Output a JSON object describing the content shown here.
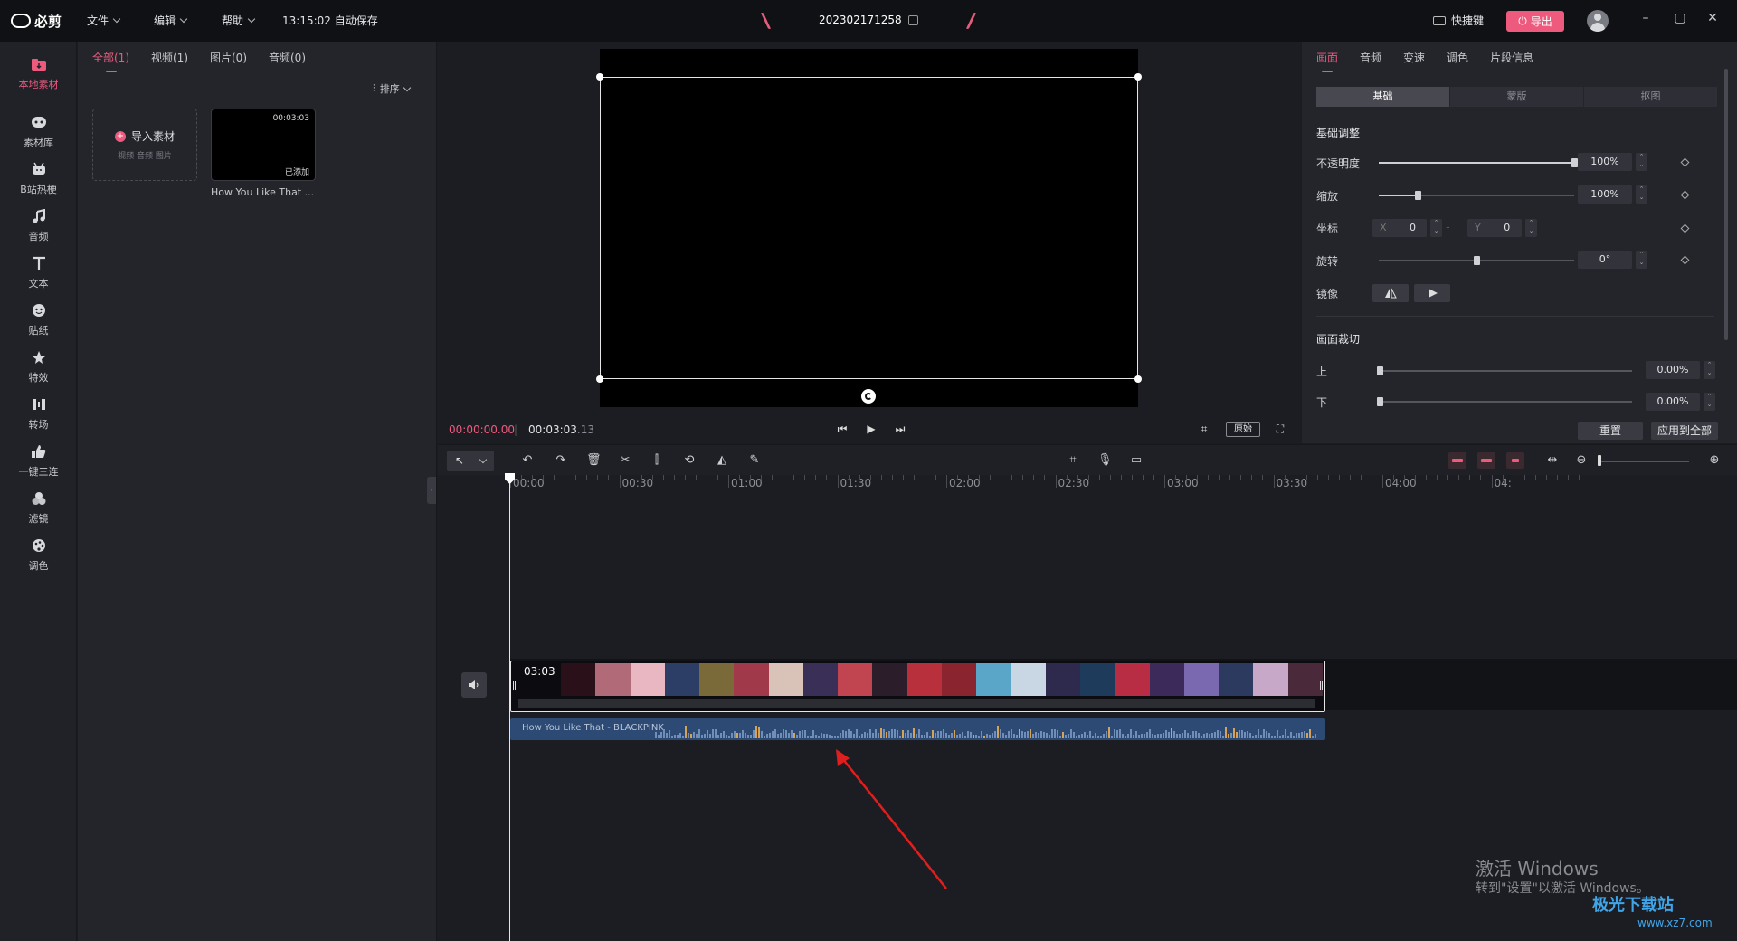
{
  "top": {
    "menus": [
      "文件",
      "编辑",
      "帮助"
    ],
    "autosave": "13:15:02 自动保存",
    "project_title": "202302171258",
    "shortcut": "快捷键",
    "export": "导出"
  },
  "nav": [
    {
      "label": "本地素材",
      "icon": "folder-icon",
      "active": true
    },
    {
      "label": "素材库",
      "icon": "library-icon"
    },
    {
      "label": "B站热梗",
      "icon": "bilibili-icon"
    },
    {
      "label": "音频",
      "icon": "music-icon"
    },
    {
      "label": "文本",
      "icon": "text-icon"
    },
    {
      "label": "贴纸",
      "icon": "sticker-icon"
    },
    {
      "label": "特效",
      "icon": "effect-icon"
    },
    {
      "label": "转场",
      "icon": "transition-icon"
    },
    {
      "label": "一键三连",
      "icon": "thumbs-up-icon"
    },
    {
      "label": "滤镜",
      "icon": "filter-icon"
    },
    {
      "label": "调色",
      "icon": "palette-icon"
    }
  ],
  "media": {
    "tabs": [
      "全部(1)",
      "视频(1)",
      "图片(0)",
      "音频(0)"
    ],
    "sort": "排序",
    "import_title": "导入素材",
    "import_sub": "视频 音频 图片",
    "thumb_duration": "00:03:03",
    "thumb_added": "已添加",
    "thumb_name": "How You Like That ..."
  },
  "preview": {
    "current_time": "00:00:00.00",
    "total_time_main": "00:03:03",
    "total_time_frac": ".13",
    "origin": "原始"
  },
  "props": {
    "tabs": [
      "画面",
      "音频",
      "变速",
      "调色",
      "片段信息"
    ],
    "seg": [
      "基础",
      "蒙版",
      "抠图"
    ],
    "section_basic": "基础调整",
    "opacity_label": "不透明度",
    "opacity_value": "100%",
    "opacity_level": 1.0,
    "scale_label": "缩放",
    "scale_value": "100%",
    "scale_level": 0.2,
    "pos_label": "坐标",
    "pos_x_label": "X",
    "pos_x": "0",
    "pos_y_label": "Y",
    "pos_y": "0",
    "rotate_label": "旋转",
    "rotate_value": "0°",
    "rotate_level": 0.5,
    "mirror_label": "镜像",
    "section_crop": "画面裁切",
    "crop_top_label": "上",
    "crop_top_value": "0.00%",
    "crop_bottom_label": "下",
    "crop_bottom_value": "0.00%",
    "reset": "重置",
    "apply_all": "应用到全部"
  },
  "timeline": {
    "ruler": [
      "00:00",
      "00:30",
      "01:00",
      "01:30",
      "02:00",
      "02:30",
      "03:00",
      "03:30",
      "04:00",
      "04:"
    ],
    "clip_duration": "03:03",
    "audio_name": "How You Like That - BLACKPINK"
  },
  "overlay": {
    "activate_title": "激活 Windows",
    "activate_sub": "转到\"设置\"以激活 Windows。",
    "site_name": "极光下载站",
    "site_url": "www.xz7.com"
  },
  "colors": {
    "accent": "#ee5a7e",
    "background": "#1b1c21",
    "audio_clip": "#2c4a73",
    "annotation_arrow": "#e01e1e"
  }
}
